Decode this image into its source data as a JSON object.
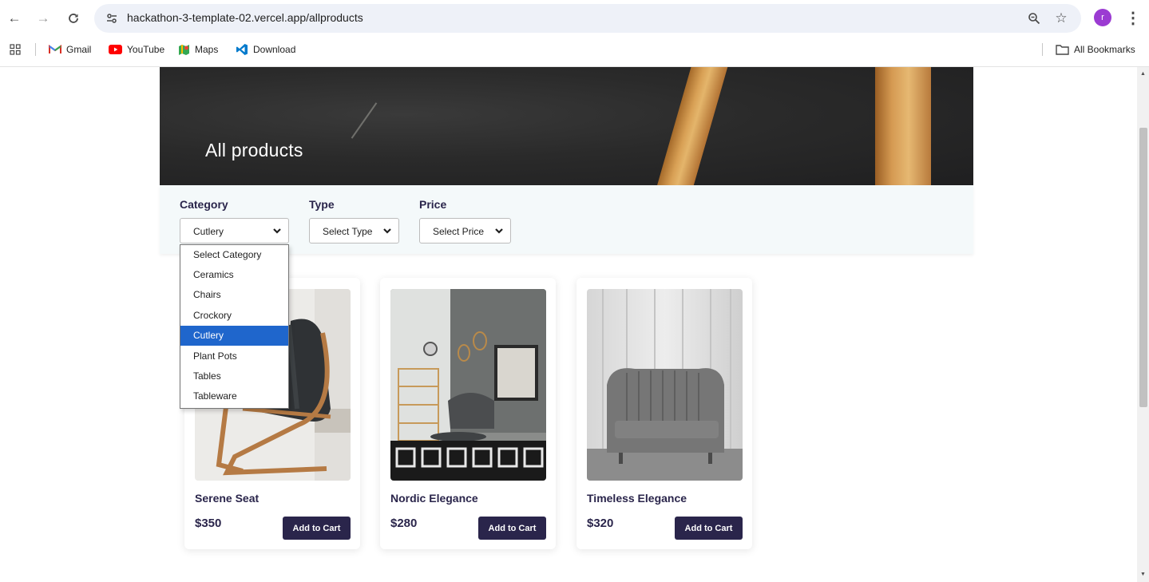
{
  "browser": {
    "url": "hackathon-3-template-02.vercel.app/allproducts",
    "profile_initial": "r",
    "bookmarks": [
      {
        "label": "Gmail",
        "icon": "gmail-icon"
      },
      {
        "label": "YouTube",
        "icon": "youtube-icon"
      },
      {
        "label": "Maps",
        "icon": "maps-icon"
      },
      {
        "label": "Download",
        "icon": "vscode-icon"
      }
    ],
    "all_bookmarks": "All Bookmarks"
  },
  "hero": {
    "title": "All products"
  },
  "filters": {
    "category": {
      "label": "Category",
      "value": "Cutlery"
    },
    "type": {
      "label": "Type",
      "value": "Select Type"
    },
    "price": {
      "label": "Price",
      "value": "Select Price"
    }
  },
  "category_dropdown": {
    "options": [
      "Select Category",
      "Ceramics",
      "Chairs",
      "Crockory",
      "Cutlery",
      "Plant Pots",
      "Tables",
      "Tableware"
    ],
    "selected": "Cutlery"
  },
  "products": [
    {
      "name": "Serene Seat",
      "price": "$350",
      "button": "Add to Cart"
    },
    {
      "name": "Nordic Elegance",
      "price": "$280",
      "button": "Add to Cart"
    },
    {
      "name": "Timeless Elegance",
      "price": "$320",
      "button": "Add to Cart"
    }
  ],
  "colors": {
    "brand_dark": "#2a254b",
    "filter_bg": "#f4f9fa",
    "dropdown_highlight": "#1f66cc"
  }
}
